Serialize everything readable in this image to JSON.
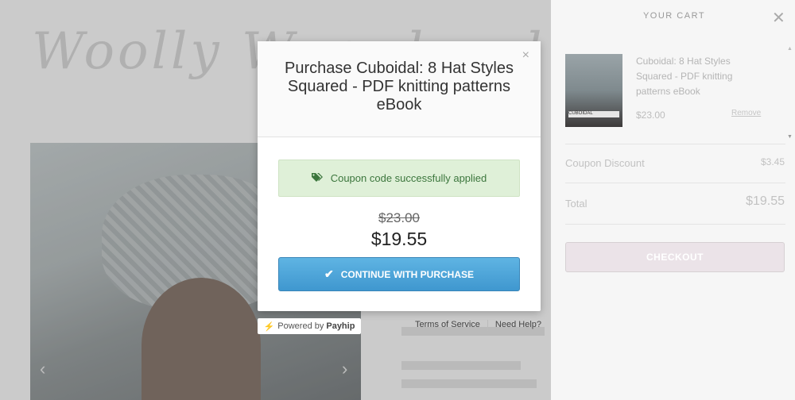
{
  "store": {
    "logo_text": "Woolly Wormhead"
  },
  "modal": {
    "title": "Purchase Cuboidal: 8 Hat Styles Squared - PDF knitting patterns eBook",
    "close_icon": "×",
    "coupon_message": "Coupon code successfully applied",
    "old_price": "$23.00",
    "new_price": "$19.55",
    "continue_label": "CONTINUE WITH PURCHASE",
    "powered_prefix": "Powered by",
    "powered_brand": "Payhip",
    "terms_link": "Terms of Service",
    "help_link": "Need Help?"
  },
  "cart": {
    "title": "YOUR CART",
    "item": {
      "name": "Cuboidal: 8 Hat Styles Squared - PDF knitting patterns eBook",
      "price": "$23.00",
      "remove_label": "Remove",
      "thumb_label": "CUBOIDAL"
    },
    "coupon_label": "Coupon Discount",
    "coupon_value": "$3.45",
    "total_label": "Total",
    "total_value": "$19.55",
    "checkout_label": "CHECKOUT"
  },
  "colors": {
    "coupon_bg": "#dff0d8",
    "coupon_text": "#3c763d",
    "continue_btn": "#4aa3d8",
    "checkout_btn": "#ebe3e8"
  },
  "icons": {
    "modal_close": "close-icon",
    "coupon": "tag-icon",
    "continue": "check-icon",
    "powered": "bolt-icon",
    "cart_close": "close-icon"
  }
}
